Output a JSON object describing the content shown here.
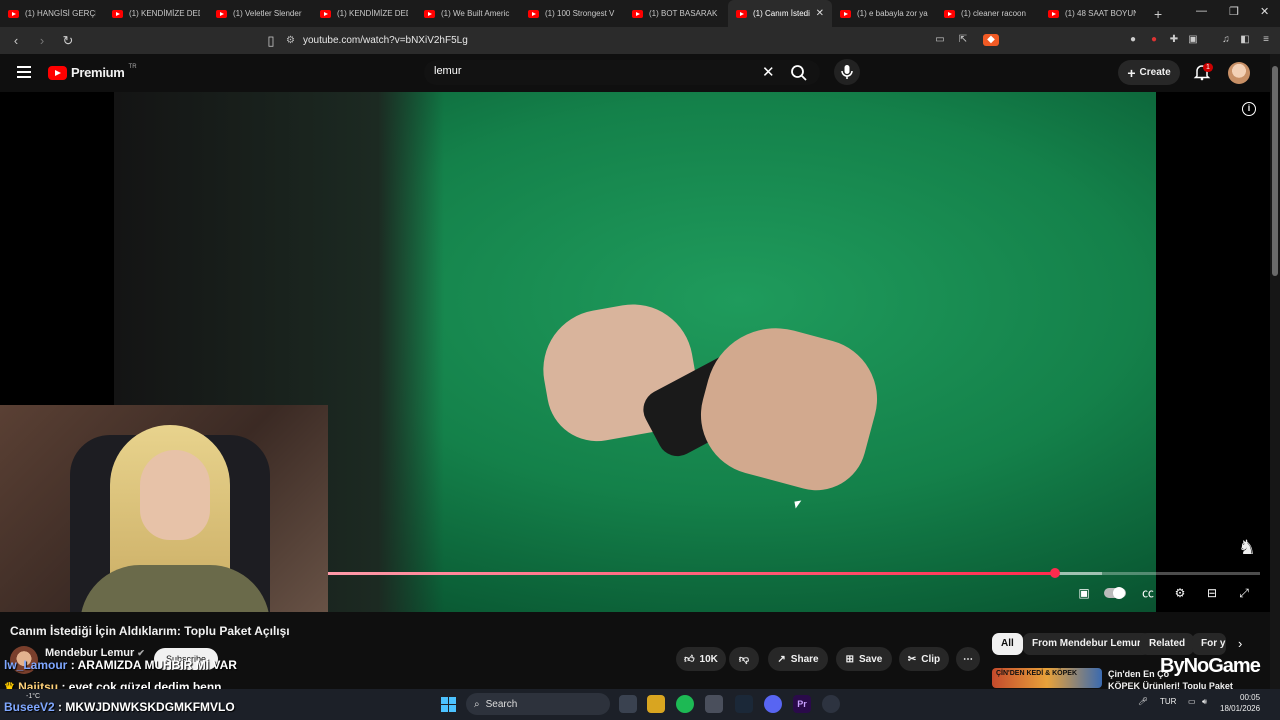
{
  "browser": {
    "tabs": [
      {
        "label": "(1) HANGİSİ GERÇEK"
      },
      {
        "label": "(1) KENDİMİZE DEDE"
      },
      {
        "label": "(1) Veletler Slender"
      },
      {
        "label": "(1) KENDİMİZE DED"
      },
      {
        "label": "(1) We Built Americ"
      },
      {
        "label": "(1) 100 Strongest V"
      },
      {
        "label": "(1) BOT BASARAK K"
      },
      {
        "label": "(1) Canım İstedi",
        "active": true
      },
      {
        "label": "(1) e babayla zor ya"
      },
      {
        "label": "(1) cleaner racoon"
      },
      {
        "label": "(1) 48 SAAT BOYUN"
      }
    ],
    "url": "youtube.com/watch?v=bNXiV2hF5Lg"
  },
  "youtube": {
    "brand": "Premium",
    "country": "TR",
    "search_value": "lemur",
    "create_label": "Create",
    "notification_count": "1"
  },
  "video": {
    "progress_played": 0.78,
    "progress_buffered": 0.83,
    "title": "Canım İstediği İçin Aldıklarım: Toplu Paket Açılışı",
    "channel": "Mendebur Lemur",
    "subscribe_label": "Subscribe",
    "likes": "10K",
    "share_label": "Share",
    "save_label": "Save",
    "clip_label": "Clip"
  },
  "chips": [
    "All",
    "From Mendebur Lemur",
    "Related",
    "For y"
  ],
  "next_video": {
    "thumb_text": "ÇİN'DEN KEDİ & KÖPEK",
    "title_line1": "Çin'den En Ço",
    "title_line2": "KÖPEK Ürünleri! Toplu Paket"
  },
  "watermark": "ByNoGame",
  "chat": [
    {
      "user": "lw_Lamour",
      "sep": " : ",
      "message": "ARAMIZDA MUHBİR Mİ VAR"
    },
    {
      "user": "Najitsu",
      "sep": " : ",
      "message": "evet çok güzel dedim benn"
    },
    {
      "user": "BuseeV2",
      "sep": " : ",
      "message": "MKWJDNWKSKDGMKFMVLO"
    }
  ],
  "taskbar": {
    "search_label": "Search",
    "weather": "-1°C",
    "language": "TUR",
    "time": "00:05",
    "date": "18/01/2026"
  }
}
